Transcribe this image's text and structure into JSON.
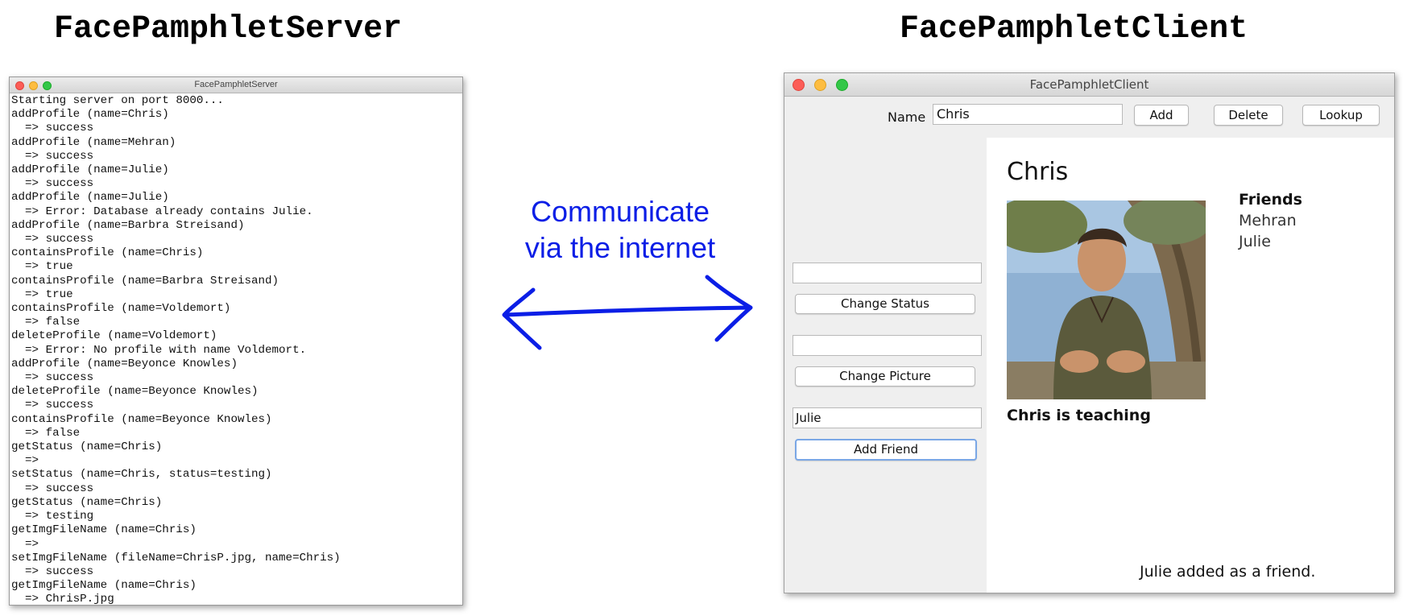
{
  "server": {
    "heading": "FacePamphletServer",
    "window_title": "FacePamphletServer",
    "log_lines": [
      "Starting server on port 8000...",
      "addProfile (name=Chris)",
      "  => success",
      "addProfile (name=Mehran)",
      "  => success",
      "addProfile (name=Julie)",
      "  => success",
      "addProfile (name=Julie)",
      "  => Error: Database already contains Julie.",
      "addProfile (name=Barbra Streisand)",
      "  => success",
      "containsProfile (name=Chris)",
      "  => true",
      "containsProfile (name=Barbra Streisand)",
      "  => true",
      "containsProfile (name=Voldemort)",
      "  => false",
      "deleteProfile (name=Voldemort)",
      "  => Error: No profile with name Voldemort.",
      "addProfile (name=Beyonce Knowles)",
      "  => success",
      "deleteProfile (name=Beyonce Knowles)",
      "  => success",
      "containsProfile (name=Beyonce Knowles)",
      "  => false",
      "getStatus (name=Chris)",
      "  =>",
      "setStatus (name=Chris, status=testing)",
      "  => success",
      "getStatus (name=Chris)",
      "  => testing",
      "getImgFileName (name=Chris)",
      "  =>",
      "setImgFileName (fileName=ChrisP.jpg, name=Chris)",
      "  => success",
      "getImgFileName (name=Chris)",
      "  => ChrisP.jpg"
    ]
  },
  "annotation": {
    "line1": "Communicate",
    "line2": "via the internet",
    "color": "#0b1ee6"
  },
  "client": {
    "heading": "FacePamphletClient",
    "window_title": "FacePamphletClient",
    "toolbar": {
      "name_label": "Name",
      "name_value": "Chris",
      "add_label": "Add",
      "delete_label": "Delete",
      "lookup_label": "Lookup"
    },
    "side": {
      "status_field_value": "",
      "change_status_label": "Change Status",
      "picture_field_value": "",
      "change_picture_label": "Change Picture",
      "friend_field_value": "Julie",
      "add_friend_label": "Add Friend"
    },
    "profile": {
      "name": "Chris",
      "status": "Chris is teaching",
      "friends_heading": "Friends",
      "friends": [
        "Mehran",
        "Julie"
      ],
      "message": "Julie added as a friend."
    }
  }
}
